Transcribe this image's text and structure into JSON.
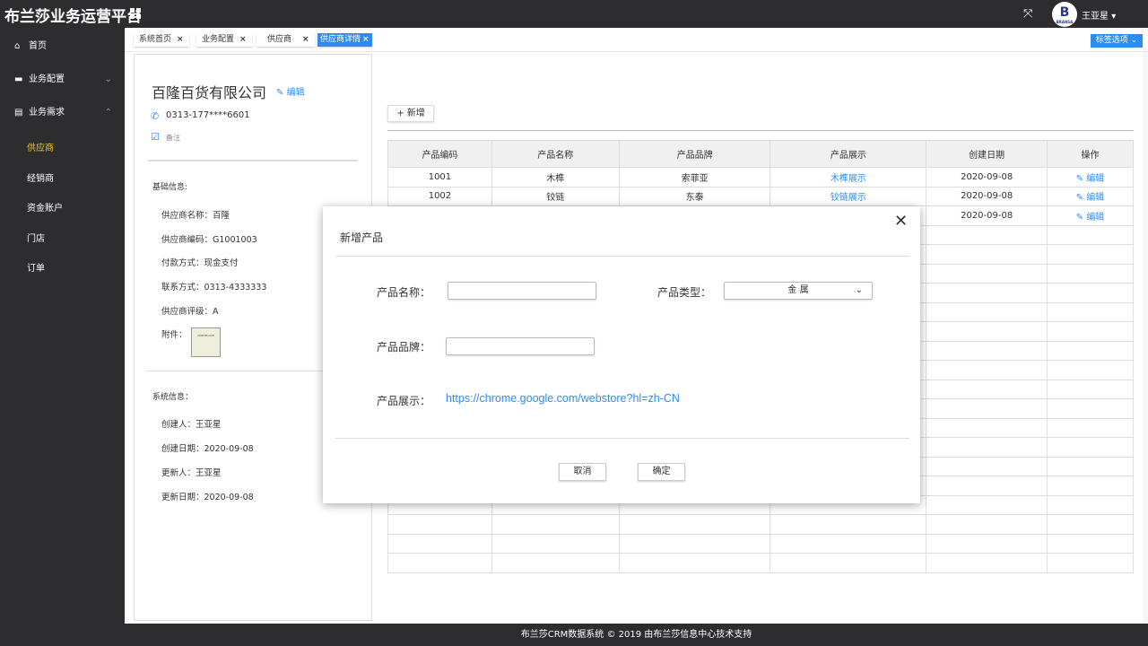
{
  "header": {
    "title": "布兰莎业务运营平台",
    "user": "王亚星",
    "avatar_text": "B",
    "avatar_sub": "BRANSA"
  },
  "sidebar": {
    "items": [
      {
        "label": "首页",
        "icon": "home-icon"
      },
      {
        "label": "业务配置",
        "icon": "briefcase-icon"
      },
      {
        "label": "业务需求",
        "icon": "document-icon"
      }
    ],
    "subitems": [
      "供应商",
      "经销商",
      "资金账户",
      "门店",
      "订单"
    ]
  },
  "tabs": [
    {
      "label": "系统首页"
    },
    {
      "label": "业务配置"
    },
    {
      "label": "供应商"
    },
    {
      "label": "供应商详情"
    }
  ],
  "tag_options": "标签选项",
  "supplier": {
    "name": "百隆百货有限公司",
    "edit": "编辑",
    "phone": "0313-177****6601",
    "note": "备注",
    "basic_title": "基础信息:",
    "basic": [
      "供应商名称：百隆",
      "供应商编码：G1001003",
      "付款方式：现金支付",
      "联系方式：0313-4333333",
      "供应商评级：A"
    ],
    "attachment": "附件：",
    "attachment_text": "CERTIFICATE",
    "system_title": "系统信息：",
    "system": [
      "创建人：王亚星",
      "创建日期：2020-09-08",
      "更新人：王亚星",
      "更新日期：2020-09-08"
    ]
  },
  "products": {
    "add": "新增",
    "headers": [
      "产品编码",
      "产品名称",
      "产品品牌",
      "产品展示",
      "创建日期",
      "操作"
    ],
    "rows": [
      [
        "1001",
        "木榫",
        "索菲亚",
        "木榫展示",
        "2020-09-08",
        "编辑"
      ],
      [
        "1002",
        "铰链",
        "东泰",
        "铰链展示",
        "2020-09-08",
        "编辑"
      ],
      [
        "",
        "",
        "",
        "",
        "2020-09-08",
        "编辑"
      ]
    ]
  },
  "dialog": {
    "title": "新增产品",
    "name_label": "产品名称：",
    "name_value": "",
    "type_label": "产品类型：",
    "type_value": "金 属",
    "brand_label": "产品品牌：",
    "brand_value": "",
    "show_label": "产品展示：",
    "show_url": "https://chrome.google.com/webstore?hl=zh-CN",
    "cancel": "取消",
    "ok": "确定"
  },
  "footer": "布兰莎CRM数据系统 © 2019 由布兰莎信息中心技术支持"
}
